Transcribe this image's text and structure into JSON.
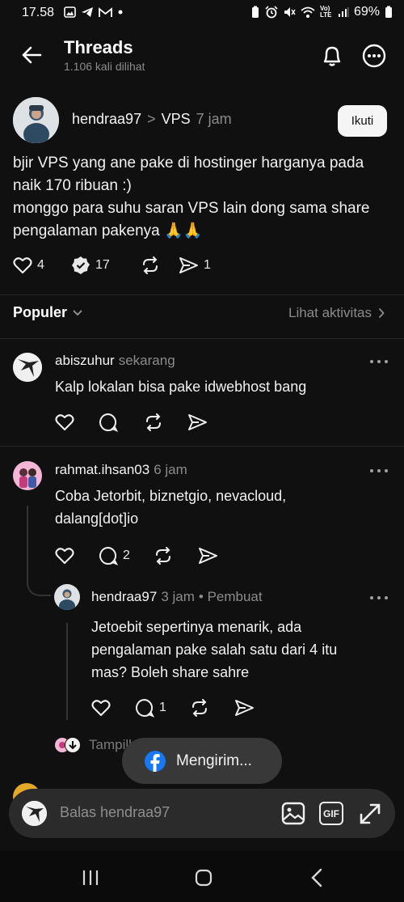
{
  "status_bar": {
    "time": "17.58",
    "battery": "69%",
    "network": "Vo) LTE"
  },
  "header": {
    "title": "Threads",
    "subtitle": "1.106 kali dilihat"
  },
  "post": {
    "username": "hendraa97",
    "separator": ">",
    "topic": "VPS",
    "time": "7 jam",
    "follow_label": "Ikuti",
    "text_lines": [
      "bjir VPS yang ane pake di hostinger harganya pada",
      "naik 170 ribuan :)",
      "monggo para suhu saran VPS lain dong sama share",
      "pengalaman pakenya 🙏🙏"
    ],
    "likes": "4",
    "comments": "17",
    "shares": "1"
  },
  "sort": {
    "label": "Populer",
    "activity_link": "Lihat aktivitas"
  },
  "comments": [
    {
      "username": "abiszuhur",
      "time": "sekarang",
      "text_lines": [
        "Kalp lokalan bisa pake idwebhost bang"
      ],
      "reply_count": ""
    },
    {
      "username": "rahmat.ihsan03",
      "time": "6 jam",
      "text_lines": [
        "Coba Jetorbit, biznetgio, nevacloud,",
        "dalang[dot]io"
      ],
      "reply_count": "2"
    },
    {
      "username": "hendraa97",
      "time": "3 jam",
      "creator_tag": "• Pembuat",
      "text_lines": [
        "Jetoebit sepertinya menarik, ada",
        "pengalaman pake salah satu dari 4 itu",
        "mas? Boleh share sahre"
      ],
      "reply_count": "1"
    }
  ],
  "show_replies_label": "Tampilkan balasan",
  "toast": {
    "label": "Mengirim..."
  },
  "reply_bar": {
    "placeholder": "Balas hendraa97",
    "gif_label": "GIF"
  },
  "colors": {
    "background": "#101010",
    "muted": "#8b8b8b",
    "facebook": "#1877f2",
    "verified": "#ffffff"
  }
}
